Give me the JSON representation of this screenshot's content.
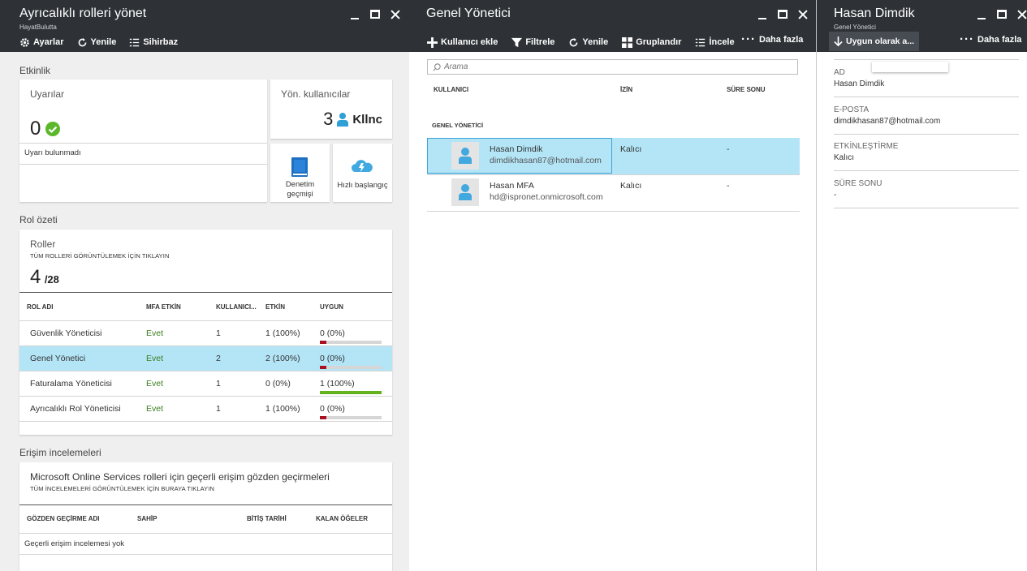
{
  "blade1": {
    "title": "Ayrıcalıklı rolleri yönet",
    "subtitle": "HayatBulutta",
    "toolbar": {
      "settings": "Ayarlar",
      "refresh": "Yenile",
      "wizard": "Sihirbaz"
    },
    "activity_label": "Etkinlik",
    "alerts": {
      "title": "Uyarılar",
      "count": "0",
      "message": "Uyarı bulunmadı"
    },
    "admins": {
      "title": "Yön. kullanıcılar",
      "count": "3",
      "unit": "Kllnc"
    },
    "audit_label": [
      "Denetim",
      "geçmişi"
    ],
    "quickstart_label": "Hızlı başlangıç",
    "role_summary_label": "Rol özeti",
    "roles": {
      "title": "Roller",
      "subtitle": "TÜM ROLLERİ GÖRÜNTÜLEMEK İÇİN TIKLAYIN",
      "count": "4",
      "total": "/28",
      "columns": [
        "ROL ADI",
        "MFA ETKİN",
        "KULLANICI...",
        "ETKİN",
        "UYGUN"
      ],
      "rows": [
        {
          "name": "Güvenlik Yöneticisi",
          "mfa": "Evet",
          "users": "1",
          "active": "1 (100%)",
          "eligible": "0 (0%)",
          "eligible_pct": 0,
          "selected": false
        },
        {
          "name": "Genel Yönetici",
          "mfa": "Evet",
          "users": "2",
          "active": "2 (100%)",
          "eligible": "0 (0%)",
          "eligible_pct": 0,
          "selected": true
        },
        {
          "name": "Faturalama Yöneticisi",
          "mfa": "Evet",
          "users": "1",
          "active": "0 (0%)",
          "eligible": "1 (100%)",
          "eligible_pct": 100,
          "selected": false
        },
        {
          "name": "Ayrıcalıklı Rol Yöneticisi",
          "mfa": "Evet",
          "users": "1",
          "active": "1 (100%)",
          "eligible": "0 (0%)",
          "eligible_pct": 0,
          "selected": false
        }
      ]
    },
    "access_reviews_label": "Erişim incelemeleri",
    "reviews": {
      "title": "Microsoft Online Services rolleri için geçerli erişim gözden geçirmeleri",
      "subtitle": "TÜM İNCELEMELERİ GÖRÜNTÜLEMEK İÇİN BURAYA TIKLAYIN",
      "columns": [
        "GÖZDEN GEÇİRME ADI",
        "SAHİP",
        "BİTİŞ TARİHİ",
        "KALAN ÖĞELER"
      ],
      "empty": "Geçerli erişim incelemesi yok"
    }
  },
  "blade2": {
    "title": "Genel Yönetici",
    "toolbar": {
      "add_user": "Kullanıcı ekle",
      "filter": "Filtrele",
      "refresh": "Yenile",
      "group": "Gruplandır",
      "review": "İncele",
      "more": "Daha fazla"
    },
    "search_placeholder": "Arama",
    "columns": [
      "KULLANICI",
      "İZİN",
      "SÜRE SONU"
    ],
    "group_label": "GENEL YÖNETİCİ",
    "users": [
      {
        "name": "Hasan Dimdik",
        "email": "dimdikhasan87@hotmail.com",
        "permission": "Kalıcı",
        "expiry": "-",
        "selected": true
      },
      {
        "name": "Hasan MFA",
        "email": "hd@ispronet.onmicrosoft.com",
        "permission": "Kalıcı",
        "expiry": "-",
        "selected": false
      }
    ]
  },
  "blade3": {
    "title": "Hasan Dimdik",
    "subtitle": "Genel Yönetici",
    "toolbar": {
      "make_eligible": "Uygun olarak a...",
      "more": "Daha fazla"
    },
    "fields": [
      {
        "label": "AD",
        "value": "Hasan Dimdik"
      },
      {
        "label": "E-POSTA",
        "value": "dimdikhasan87@hotmail.com"
      },
      {
        "label": "ETKİNLEŞTİRME",
        "value": "Kalıcı"
      },
      {
        "label": "SÜRE SONU",
        "value": "-"
      }
    ]
  },
  "colors": {
    "header_bg": "#2e3236",
    "selected_row": "#b3e5f6",
    "accent_blue": "#2b7cd3",
    "ok_green": "#5cb82b",
    "bar_red": "#a8101d",
    "bar_green": "#63b31e"
  }
}
